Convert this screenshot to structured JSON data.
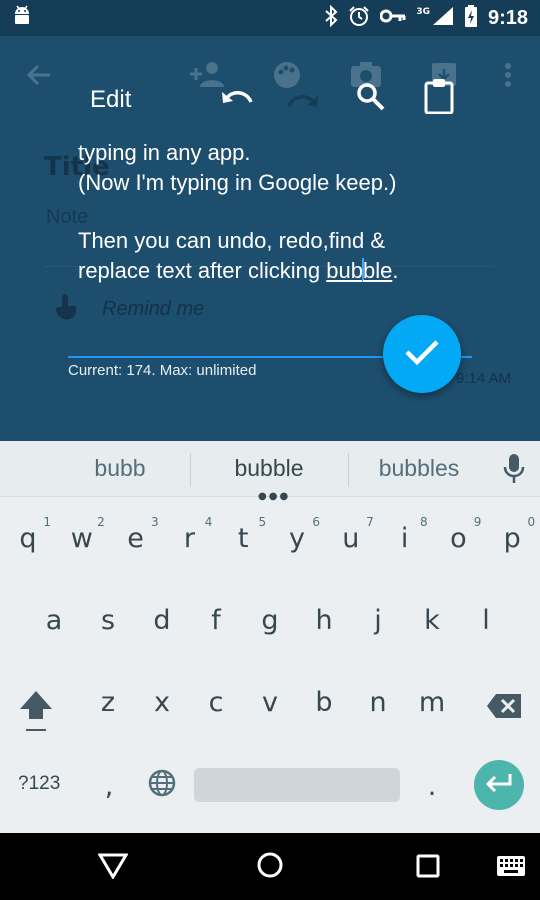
{
  "status_bar": {
    "time": "9:18",
    "network": "3G",
    "icons": [
      "android-icon",
      "bluetooth-icon",
      "alarm-icon",
      "vpn-key-icon",
      "signal-icon",
      "battery-charging-icon"
    ]
  },
  "background_app": {
    "title_placeholder": "Title",
    "note_placeholder": "Note",
    "remind_label": "Remind me",
    "edited_time": "9:14 AM",
    "toolbar_icons": [
      "back-arrow-icon",
      "add-person-icon",
      "palette-icon",
      "camera-icon",
      "archive-icon",
      "more-vert-icon"
    ]
  },
  "editor": {
    "title": "Edit",
    "toolbar_icons": [
      "undo-icon",
      "redo-icon",
      "search-icon",
      "clipboard-icon"
    ],
    "lines": {
      "line1": "typing in any app.",
      "line2": "(Now I'm typing in Google keep.)",
      "line3": "Then you can undo, redo,find &",
      "line4_prefix": "replace text after clicking ",
      "line4_word_a": "bub",
      "line4_word_b": "ble",
      "line4_suffix": "."
    },
    "counter": "Current: 174. Max: unlimited",
    "confirm_icon": "check-icon",
    "accent": "#03a9f4"
  },
  "keyboard": {
    "suggestions": [
      "bubb",
      "bubble",
      "bubbles"
    ],
    "row1": [
      {
        "k": "q",
        "h": "1"
      },
      {
        "k": "w",
        "h": "2"
      },
      {
        "k": "e",
        "h": "3"
      },
      {
        "k": "r",
        "h": "4"
      },
      {
        "k": "t",
        "h": "5"
      },
      {
        "k": "y",
        "h": "6"
      },
      {
        "k": "u",
        "h": "7"
      },
      {
        "k": "i",
        "h": "8"
      },
      {
        "k": "o",
        "h": "9"
      },
      {
        "k": "p",
        "h": "0"
      }
    ],
    "row2": [
      "a",
      "s",
      "d",
      "f",
      "g",
      "h",
      "j",
      "k",
      "l"
    ],
    "row3": [
      "z",
      "x",
      "c",
      "v",
      "b",
      "n",
      "m"
    ],
    "symbols_label": "?123",
    "comma": ",",
    "period": ".",
    "enter_color": "#4db6ac"
  },
  "nav_bar": {
    "icons": [
      "back-triangle-icon",
      "home-circle-icon",
      "recents-square-icon",
      "keyboard-switch-icon"
    ]
  }
}
